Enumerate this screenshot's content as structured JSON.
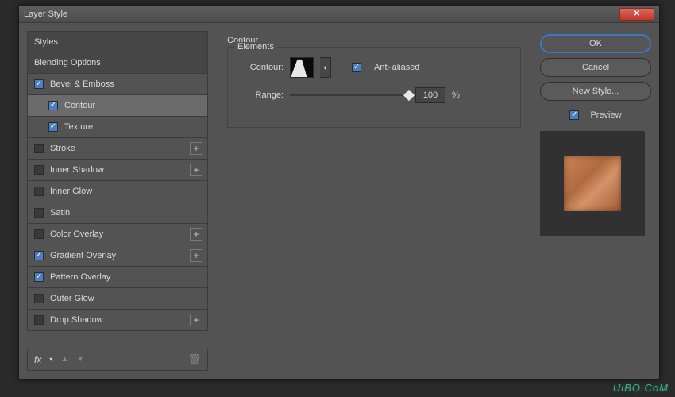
{
  "window": {
    "title": "Layer Style"
  },
  "sidebar": {
    "items": [
      {
        "label": "Styles",
        "type": "header"
      },
      {
        "label": "Blending Options",
        "type": "header"
      },
      {
        "label": "Bevel & Emboss",
        "checked": true
      },
      {
        "label": "Contour",
        "checked": true,
        "sub": true,
        "selected": true
      },
      {
        "label": "Texture",
        "checked": true,
        "sub": true
      },
      {
        "label": "Stroke",
        "checked": false,
        "plus": true
      },
      {
        "label": "Inner Shadow",
        "checked": false,
        "plus": true
      },
      {
        "label": "Inner Glow",
        "checked": false
      },
      {
        "label": "Satin",
        "checked": false
      },
      {
        "label": "Color Overlay",
        "checked": false,
        "plus": true
      },
      {
        "label": "Gradient Overlay",
        "checked": true,
        "plus": true
      },
      {
        "label": "Pattern Overlay",
        "checked": true
      },
      {
        "label": "Outer Glow",
        "checked": false
      },
      {
        "label": "Drop Shadow",
        "checked": false,
        "plus": true
      }
    ],
    "fx_label": "fx"
  },
  "panel": {
    "title": "Contour",
    "group": "Elements",
    "contour_label": "Contour:",
    "antialiased_label": "Anti-aliased",
    "antialiased": true,
    "range_label": "Range:",
    "range_value": "100",
    "range_suffix": "%"
  },
  "buttons": {
    "ok": "OK",
    "cancel": "Cancel",
    "new_style": "New Style...",
    "preview": "Preview",
    "preview_checked": true
  },
  "watermark": "UiBO.CoM"
}
